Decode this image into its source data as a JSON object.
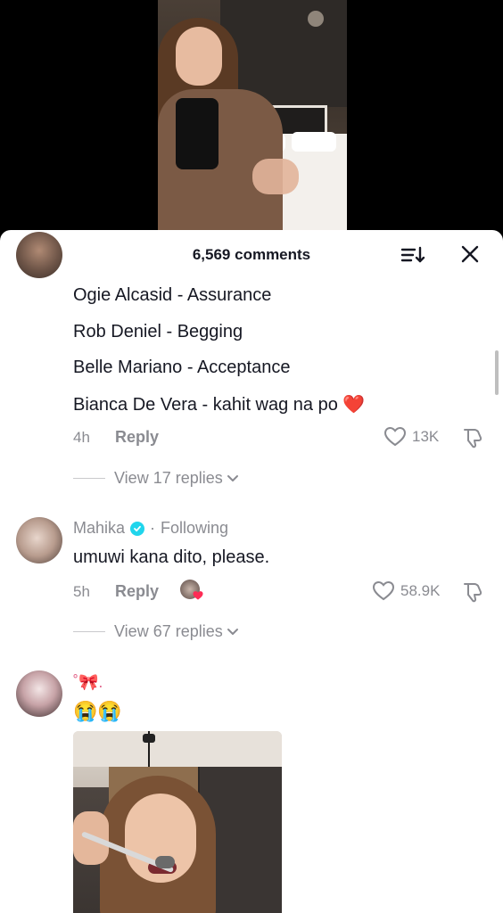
{
  "header": {
    "comment_count": "6,569 comments",
    "sort_icon": "sort-icon",
    "close_icon": "close-icon"
  },
  "comment_1": {
    "lines": [
      "Ogie Alcasid - Assurance",
      "Rob Deniel - Begging",
      "Belle Mariano - Acceptance",
      "Bianca De Vera - kahit wag na po ❤️"
    ],
    "time": "4h",
    "reply_label": "Reply",
    "likes": "13K",
    "view_replies": "View 17 replies"
  },
  "comment_2": {
    "username": "Mahika",
    "following": "Following",
    "separator": "·",
    "text": "umuwi kana dito, please.",
    "time": "5h",
    "reply_label": "Reply",
    "likes": "58.9K",
    "view_replies": "View 67 replies"
  },
  "comment_3": {
    "username": "˚🎀.",
    "text": "😭😭"
  },
  "colors": {
    "verified": "#20d5ec",
    "heart": "#fe2c55",
    "text_primary": "#161823",
    "text_secondary": "#8a8b91"
  }
}
